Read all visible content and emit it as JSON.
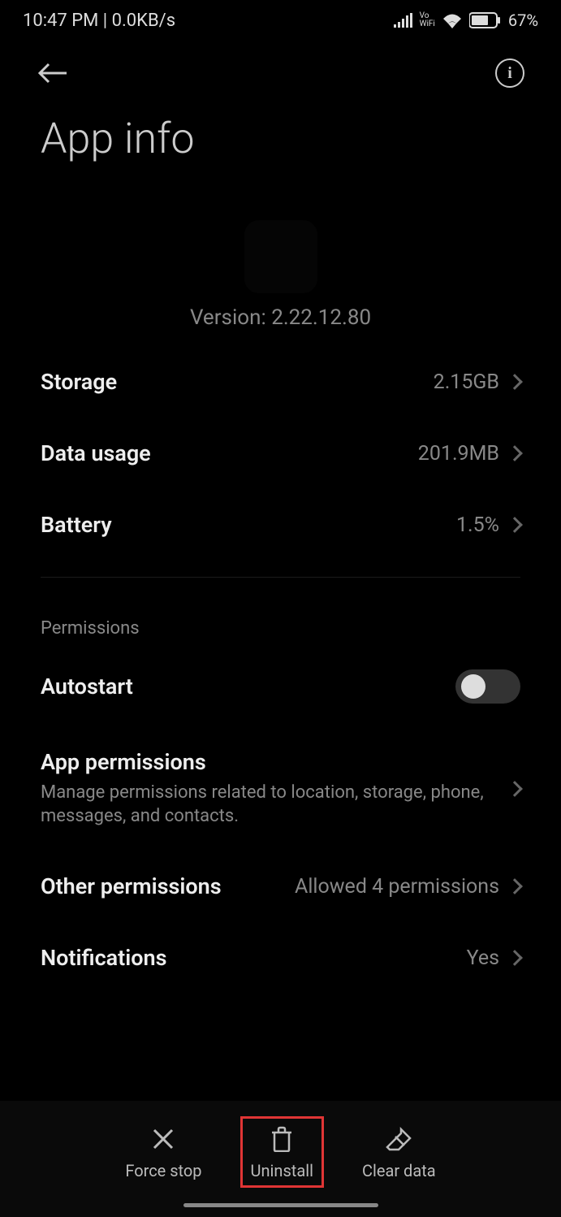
{
  "statusbar": {
    "time_net": "10:47 PM | 0.0KB/s",
    "battery": "67%",
    "vowifi_top": "Vo",
    "vowifi_bottom": "WiFi"
  },
  "header": {
    "title": "App info"
  },
  "app": {
    "version": "Version: 2.22.12.80"
  },
  "rows": {
    "storage": {
      "label": "Storage",
      "value": "2.15GB"
    },
    "data": {
      "label": "Data usage",
      "value": "201.9MB"
    },
    "battery": {
      "label": "Battery",
      "value": "1.5%"
    }
  },
  "permissions": {
    "section": "Permissions",
    "autostart": {
      "label": "Autostart"
    },
    "app_perms": {
      "label": "App permissions",
      "sub": "Manage permissions related to location, storage, phone, messages, and contacts."
    },
    "other": {
      "label": "Other permissions",
      "value": "Allowed 4 permissions"
    },
    "notifications": {
      "label": "Notifications",
      "value": "Yes"
    }
  },
  "actions": {
    "force_stop": "Force stop",
    "uninstall": "Uninstall",
    "clear_data": "Clear data"
  }
}
